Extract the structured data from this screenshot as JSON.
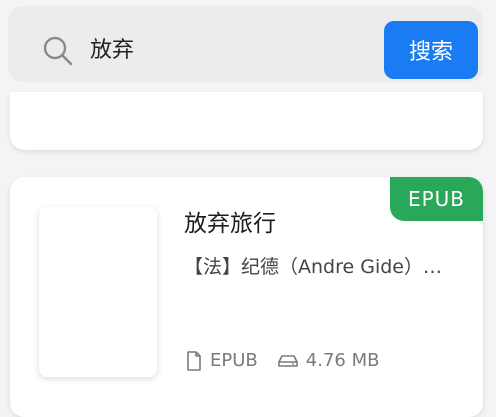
{
  "search": {
    "query": "放弃",
    "button_label": "搜索",
    "accent_color": "#1a7cf2"
  },
  "result": {
    "badge": "EPUB",
    "badge_color": "#2aa85a",
    "title": "放弃旅行",
    "author": "【法】纪德（Andre Gide）…",
    "format": "EPUB",
    "size": "4.76 MB",
    "format_icon": "file-icon",
    "size_icon": "storage-icon"
  }
}
